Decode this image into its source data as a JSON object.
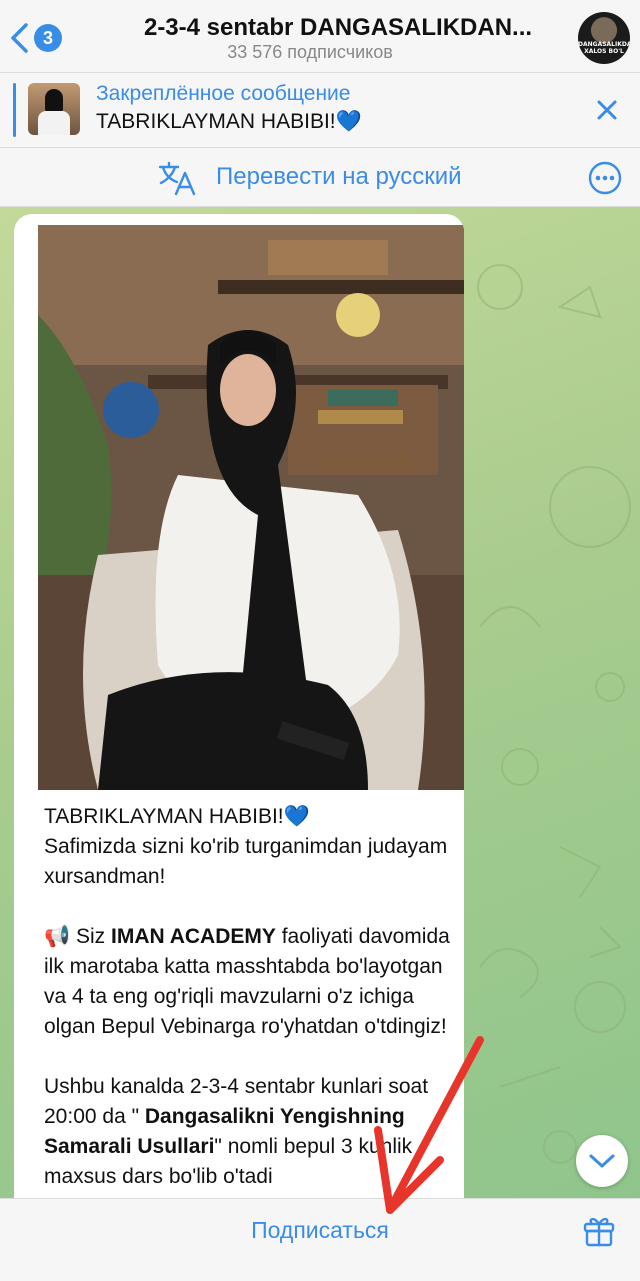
{
  "header": {
    "back_badge": "3",
    "title": "2-3-4 sentabr DANGASALIKDAN...",
    "subscribers": "33 576 подписчиков",
    "avatar_caption": "DANGASALIKDAN XALOS BO'L"
  },
  "pinned": {
    "title": "Закреплённое сообщение",
    "text": "TABRIKLAYMAN HABIBI!💙"
  },
  "translate": {
    "label": "Перевести на русский"
  },
  "message": {
    "line1": "TABRIKLAYMAN HABIBI!💙",
    "line2": "Safimizda sizni ko'rib turganimdan judayam xursandman!",
    "p2_icon": "📢",
    "p2_pre": " Siz ",
    "p2_bold": "IMAN ACADEMY",
    "p2_post": " faoliyati davomida ilk marotaba katta masshtabda bo'layotgan va  4 ta eng og'riqli mavzularni o'z ichiga olgan Bepul Vebinarga ro'yhatdan o'tdingiz!",
    "p3_pre": "Ushbu kanalda 2-3-4 sentabr kunlari soat 20:00 da \" ",
    "p3_bold": "Dangasalikni Yengishning Samarali Usullari",
    "p3_post": "\" nomli bepul 3 kunlik maxsus dars bo'lib o'tadi"
  },
  "footer": {
    "subscribe": "Подписаться"
  },
  "colors": {
    "accent": "#3a8de6",
    "annotation_arrow": "#e8352b"
  }
}
